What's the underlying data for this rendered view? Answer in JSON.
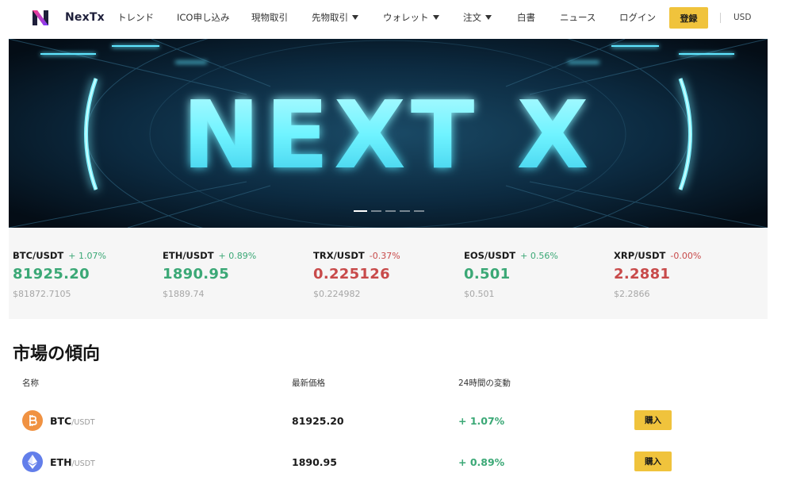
{
  "nav": {
    "brand": "NexTx",
    "items": [
      {
        "label": "トレンド",
        "dropdown": false
      },
      {
        "label": "ICO申し込み",
        "dropdown": false
      },
      {
        "label": "現物取引",
        "dropdown": false
      },
      {
        "label": "先物取引",
        "dropdown": true
      },
      {
        "label": "ウォレット",
        "dropdown": true
      },
      {
        "label": "注文",
        "dropdown": true
      },
      {
        "label": "白書",
        "dropdown": false
      },
      {
        "label": "ニュース",
        "dropdown": false
      },
      {
        "label": "ログイン",
        "dropdown": false
      }
    ],
    "register": "登録",
    "currency": "USD"
  },
  "hero": {
    "banner_text": "NEXT X",
    "slide_count": 5,
    "active_slide": 1
  },
  "ticker": [
    {
      "pair": "BTC/USDT",
      "change": "+ 1.07%",
      "price": "81925.20",
      "usd": "$81872.7105",
      "trend": "up"
    },
    {
      "pair": "ETH/USDT",
      "change": "+ 0.89%",
      "price": "1890.95",
      "usd": "$1889.74",
      "trend": "up"
    },
    {
      "pair": "TRX/USDT",
      "change": "-0.37%",
      "price": "0.225126",
      "usd": "$0.224982",
      "trend": "down"
    },
    {
      "pair": "EOS/USDT",
      "change": "+ 0.56%",
      "price": "0.501",
      "usd": "$0.501",
      "trend": "up"
    },
    {
      "pair": "XRP/USDT",
      "change": "-0.00%",
      "price": "2.2881",
      "usd": "$2.2866",
      "trend": "down"
    }
  ],
  "market": {
    "title": "市場の傾向",
    "headers": {
      "name": "名称",
      "price": "最新価格",
      "change": "24時間の変動"
    },
    "rows": [
      {
        "symbol": "BTC",
        "quote": "/USDT",
        "price": "81925.20",
        "change": "+ 1.07%",
        "trend": "up",
        "action": "購入",
        "icon": "bitcoin-icon",
        "color": "#f09242"
      },
      {
        "symbol": "ETH",
        "quote": "/USDT",
        "price": "1890.95",
        "change": "+ 0.89%",
        "trend": "up",
        "action": "購入",
        "icon": "ethereum-icon",
        "color": "#627eea"
      }
    ]
  },
  "colors": {
    "accent": "#f0c33c",
    "up": "#3ba876",
    "down": "#c84a4a",
    "brand_dark": "#1e1f3a",
    "hero_glow": "#6ff3ff"
  }
}
